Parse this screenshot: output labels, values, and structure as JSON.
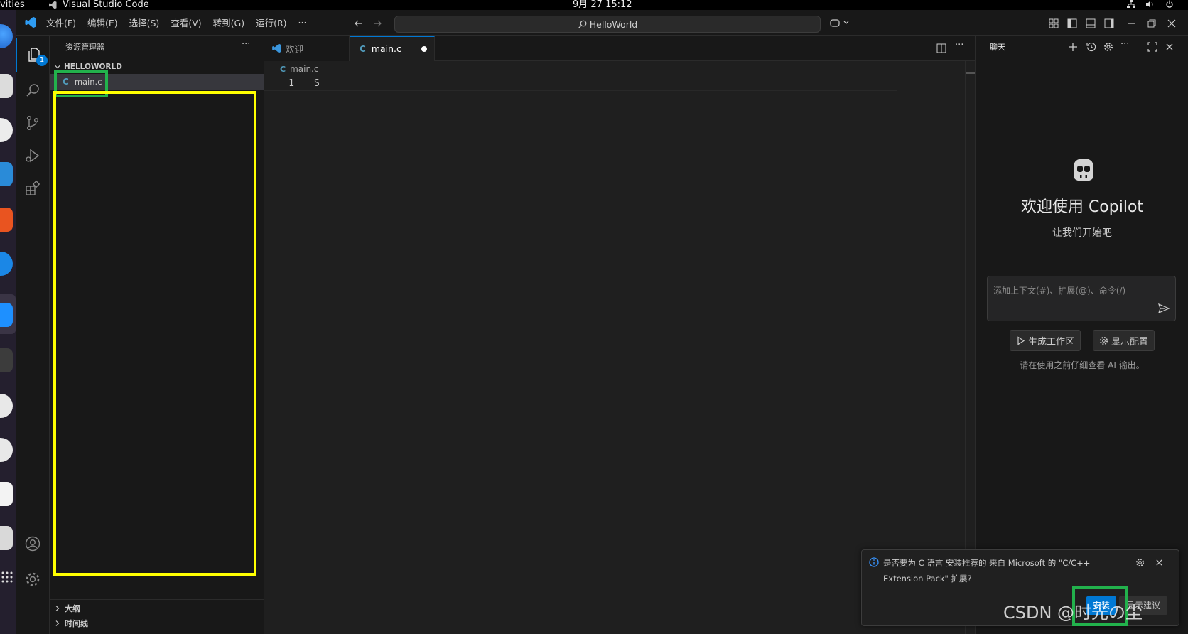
{
  "system_bar": {
    "activities": "vities",
    "app_name": "Visual Studio Code",
    "clock": "9月 27  15:12"
  },
  "menu": [
    "文件(F)",
    "编辑(E)",
    "选择(S)",
    "查看(V)",
    "转到(G)",
    "运行(R)",
    "···"
  ],
  "command_center": {
    "text": "HelloWorld"
  },
  "activity_bar": {
    "explorer_badge": "1"
  },
  "sidebar": {
    "title": "资源管理器",
    "more": "···",
    "folder": "HELLOWORLD",
    "files": [
      {
        "icon": "C",
        "name": "main.c"
      }
    ],
    "sections": [
      "大纲",
      "时间线"
    ]
  },
  "tabs": [
    {
      "label": "欢迎",
      "active": false
    },
    {
      "label": "main.c",
      "active": true,
      "icon": "C",
      "dirty": true
    }
  ],
  "breadcrumb": {
    "icon": "C",
    "file": "main.c"
  },
  "editor": {
    "lines": [
      {
        "number": "1",
        "text": "S"
      }
    ]
  },
  "chat": {
    "tab_label": "聊天",
    "welcome_title": "欢迎使用 Copilot",
    "welcome_subtitle": "让我们开始吧",
    "input_placeholder": "添加上下文(#)、扩展(@)、命令(/)",
    "buttons": [
      "生成工作区",
      "显示配置"
    ],
    "disclaimer": "请在使用之前仔细查看 AI 输出。"
  },
  "notification": {
    "message_line1": "是否要为 C 语言 安装推荐的 来自 Microsoft 的 \"C/C++",
    "message_line2": "Extension Pack\" 扩展?",
    "install": "安装",
    "show_recommendations": "显示建议"
  },
  "watermark": "CSDN @时光の尘",
  "colors": {
    "accent": "#0078d4",
    "c_icon": "#519aba",
    "highlight_yellow": "#ffff00",
    "highlight_green": "#22b14c"
  }
}
